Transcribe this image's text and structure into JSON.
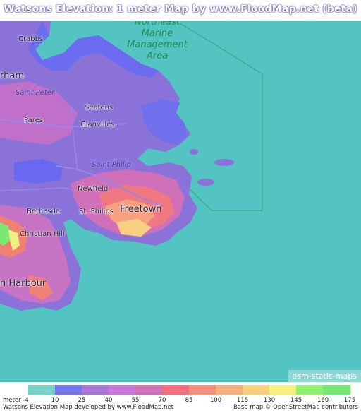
{
  "title": "Watsons Elevation: 1 meter Map by www.FloodMap.net (beta)",
  "map": {
    "marine_area": [
      "Northeast",
      "Marine",
      "Management",
      "Area"
    ],
    "places": {
      "crabbs": "Crabbs",
      "parham": "rham",
      "saint_peter": "Saint Peter",
      "seatons": "Seatons",
      "pares": "Pares",
      "glanvilles": "Glanvilles",
      "saint_philip": "Saint Philip",
      "newfield": "Newfield",
      "freetown": "Freetown",
      "bethesda": "Bethesda",
      "st_philips": "St. Philips",
      "christian_hill": "Christian Hill",
      "harbour": "n Harbour"
    },
    "badge": "osm-static-maps"
  },
  "legend": {
    "unit_label": "meter -4",
    "ticks": [
      "10",
      "25",
      "40",
      "55",
      "70",
      "85",
      "100",
      "115",
      "130",
      "145",
      "160",
      "175"
    ],
    "colors": [
      "#78d4c8",
      "#7777f0",
      "#a878d8",
      "#c878d8",
      "#d070b8",
      "#f07080",
      "#f89080",
      "#f8b080",
      "#f8d080",
      "#f8f080",
      "#90f070",
      "#78e878"
    ]
  },
  "footer": {
    "left": "Watsons Elevation Map developed by www.FloodMap.net",
    "right": "Base map © OpenStreetMap contributors"
  }
}
